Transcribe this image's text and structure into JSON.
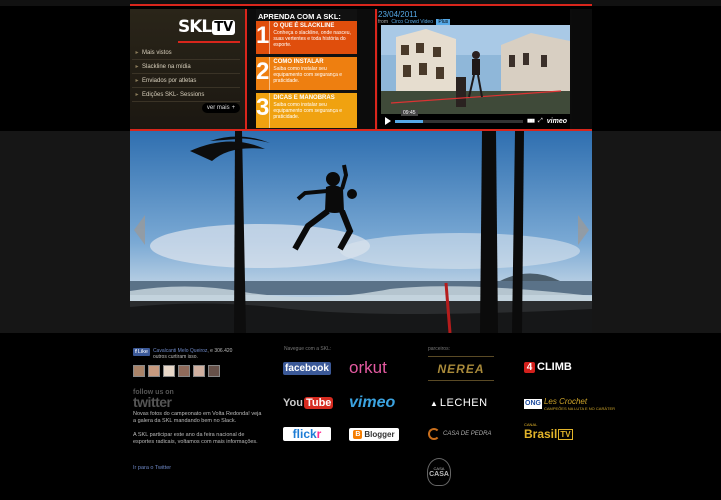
{
  "skltv": {
    "logo_text": "SKL",
    "logo_tv": "TV",
    "menu": [
      "Mais vistos",
      "Slackline na mídia",
      "Enviados por atletas",
      "Edições SKL- Sessions"
    ],
    "ver_mais": "ver mais",
    "ver_mais_icon": "plus-icon"
  },
  "aprenda": {
    "title": "APRENDA COM A SKL:",
    "steps": [
      {
        "num": "1",
        "title": "O QUE É SLACKLINE",
        "desc": "Conheça o slackline, onde nasceu, suas vertentes e toda história do esporte."
      },
      {
        "num": "2",
        "title": "COMO INSTALAR",
        "desc": "Saiba como instalar seu equipamento com segurança e praticidade."
      },
      {
        "num": "3",
        "title": "DICAS E MANOBRAS",
        "desc": "Saiba como instalar seu equipamento com segurança e praticidade."
      }
    ]
  },
  "video": {
    "date": "23/04/2011",
    "from_label": "from",
    "channel": "Circo Crowd Video",
    "plus": "Plus",
    "time": "09:45",
    "progress": 0.22,
    "brand": "vimeo"
  },
  "hero": {
    "prev_icon": "arrow-left-icon",
    "next_icon": "arrow-right-icon"
  },
  "facebook": {
    "like_label": "Like",
    "count": "",
    "text_names": "Cavalcanti Melo Queiroz",
    "text_rest": ", e 306.420 outros curtiram isso."
  },
  "twitter": {
    "follow_label": "follow us on",
    "brand": "twitter",
    "user": "",
    "tweet1": "Novas fotos do campeonato em Volta Redonda! veja a galera da SKL mandando bem no Slack.",
    "tweet2": "A SKL participar este ano da feira nacional de esportes radicais, voltamos com mais informações.",
    "goto": "Ir para o Twitter"
  },
  "navegue": {
    "title": "Navegue com a SKL:",
    "facebook": "facebook",
    "orkut": "orkut",
    "youtube_you": "You",
    "youtube_tube": "Tube",
    "vimeo": "vimeo",
    "flickr_fl": "flick",
    "flickr_kr": "r",
    "blogger": "Blogger"
  },
  "parceiros": {
    "title": "parceiros:",
    "nerea": "NEREA",
    "climb": "CLIMB",
    "climb_mark": "4",
    "lechen": "LECHEN",
    "ong": "ONG",
    "ong_name": "Les Crochet",
    "ong_sub": "CAMPEÕES NA LUTA E NO CARÁTER",
    "casa": "CASA DE PEDRA",
    "canal_br": "Brasil",
    "canal_tv": "TV",
    "canal_top": "CANAL",
    "casa2_top": "CASA",
    "casa2_mid": "CASA"
  }
}
